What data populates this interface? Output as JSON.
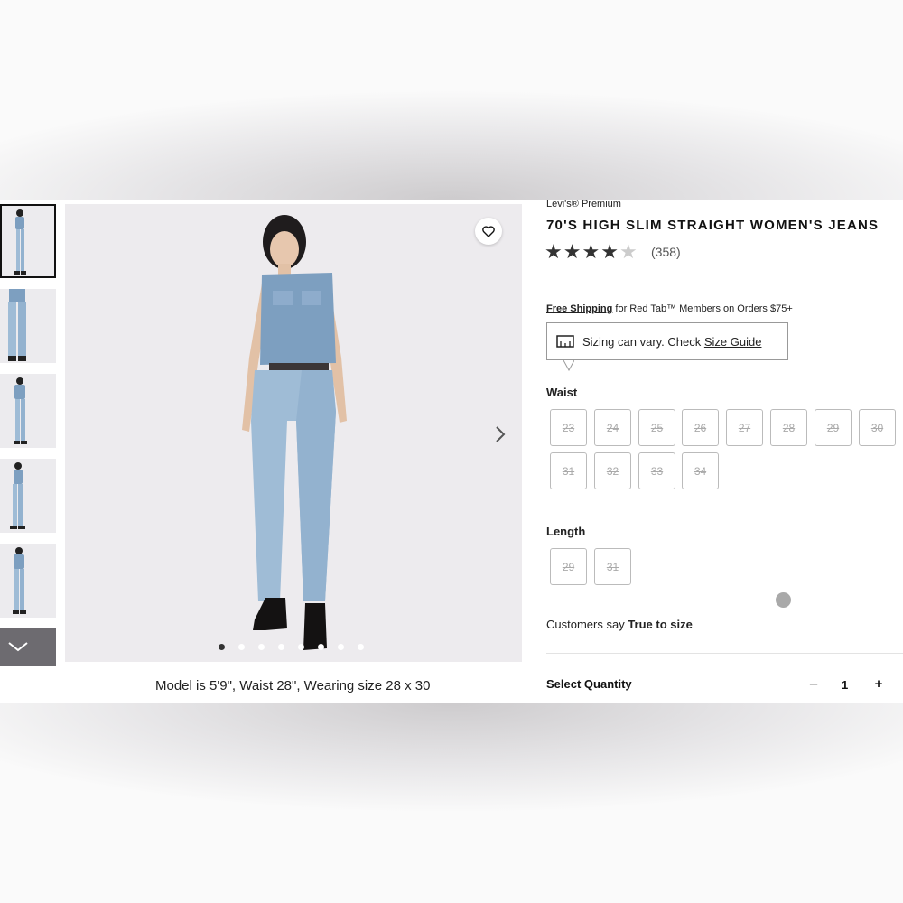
{
  "product": {
    "brand": "Levi's® Premium",
    "title": "70'S HIGH SLIM STRAIGHT WOMEN'S JEANS",
    "rating": 4,
    "rating_max": 5,
    "review_count": "(358)"
  },
  "gallery": {
    "thumbnails": [
      "front-full",
      "front-detail",
      "front-full-2",
      "side-full",
      "front-full-3"
    ],
    "selected_thumbnail": 0,
    "dot_count": 8,
    "active_dot": 0,
    "model_note": "Model is 5'9\", Waist 28\", Wearing size 28 x 30"
  },
  "shipping": {
    "link_text": "Free Shipping",
    "rest_text": " for Red Tab™ Members on Orders $75+"
  },
  "size_note": {
    "text": "Sizing can vary. Check ",
    "link": "Size Guide"
  },
  "waist": {
    "label": "Waist",
    "sizes": [
      "23",
      "24",
      "25",
      "26",
      "27",
      "28",
      "29",
      "30",
      "31",
      "32",
      "33",
      "34"
    ]
  },
  "length": {
    "label": "Length",
    "sizes": [
      "29",
      "31"
    ]
  },
  "fit": {
    "prefix": "Customers say ",
    "value": "True to size"
  },
  "quantity": {
    "label": "Select Quantity",
    "minus": "–",
    "value": "1",
    "plus": "+"
  },
  "icons": {
    "favorite": "heart-icon",
    "next": "chevron-right-icon",
    "more": "chevron-down-icon",
    "size_guide": "ruler-icon"
  },
  "colors": {
    "denim": "#9fbcd6",
    "star": "#333333"
  }
}
